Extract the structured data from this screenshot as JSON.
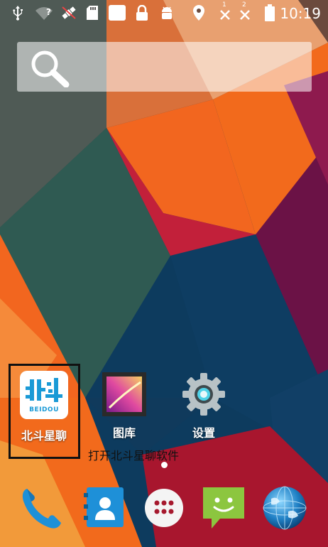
{
  "status_bar": {
    "time": "10:19",
    "icons": [
      "usb-icon",
      "wifi-unknown-icon",
      "satellite-icon",
      "sd-card-icon",
      "blank-notification-icon",
      "lock-icon",
      "android-debug-icon",
      "location-icon",
      "sim1-no-signal-icon",
      "sim2-no-signal-icon",
      "battery-icon"
    ],
    "sim1_label": "1",
    "sim2_label": "2",
    "wifi_label": "?"
  },
  "search": {
    "icon": "search-icon"
  },
  "home_apps": [
    {
      "label": "北斗星聊",
      "icon": "beidou-app-icon",
      "logo_text": "BEIDOU"
    },
    {
      "label": "图库",
      "icon": "gallery-icon"
    },
    {
      "label": "设置",
      "icon": "settings-gear-icon"
    }
  ],
  "annotation": "打开北斗星聊软件",
  "dock": [
    {
      "name": "phone",
      "icon": "phone-icon"
    },
    {
      "name": "contacts",
      "icon": "contacts-icon"
    },
    {
      "name": "all-apps",
      "icon": "app-drawer-icon"
    },
    {
      "name": "messaging",
      "icon": "messaging-icon"
    },
    {
      "name": "browser",
      "icon": "browser-globe-icon"
    }
  ],
  "colors": {
    "accent_blue": "#1a9ad6",
    "highlight_border": "#111111",
    "wallpaper_orange": "#f2661f",
    "wallpaper_navy": "#0d3b5e"
  }
}
